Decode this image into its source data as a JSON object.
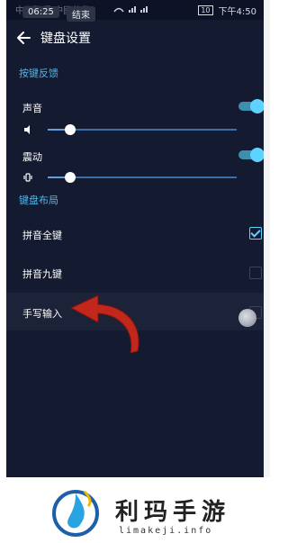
{
  "status_bar": {
    "carrier": "中國聯通 中國移動",
    "time_pill": "06:25",
    "end_pill": "结束",
    "clock": "下午4:50",
    "battery": "10"
  },
  "header": {
    "title": "键盘设置"
  },
  "feedback": {
    "section_label": "按键反馈",
    "sound_label": "声音",
    "sound_on": true,
    "sound_level": 0.12,
    "vibrate_label": "震动",
    "vibrate_on": true,
    "vibrate_level": 0.12
  },
  "layout": {
    "section_label": "键盘布局",
    "options": [
      {
        "label": "拼音全键",
        "checked": true
      },
      {
        "label": "拼音九键",
        "checked": false
      },
      {
        "label": "手写输入",
        "checked": false
      }
    ]
  },
  "banner": {
    "brand": "利玛手游",
    "domain": "limakeji.info"
  },
  "colors": {
    "accent": "#5fd3ff",
    "section": "#4fb6ea",
    "background": "#141a30",
    "arrow": "#c1271b"
  }
}
